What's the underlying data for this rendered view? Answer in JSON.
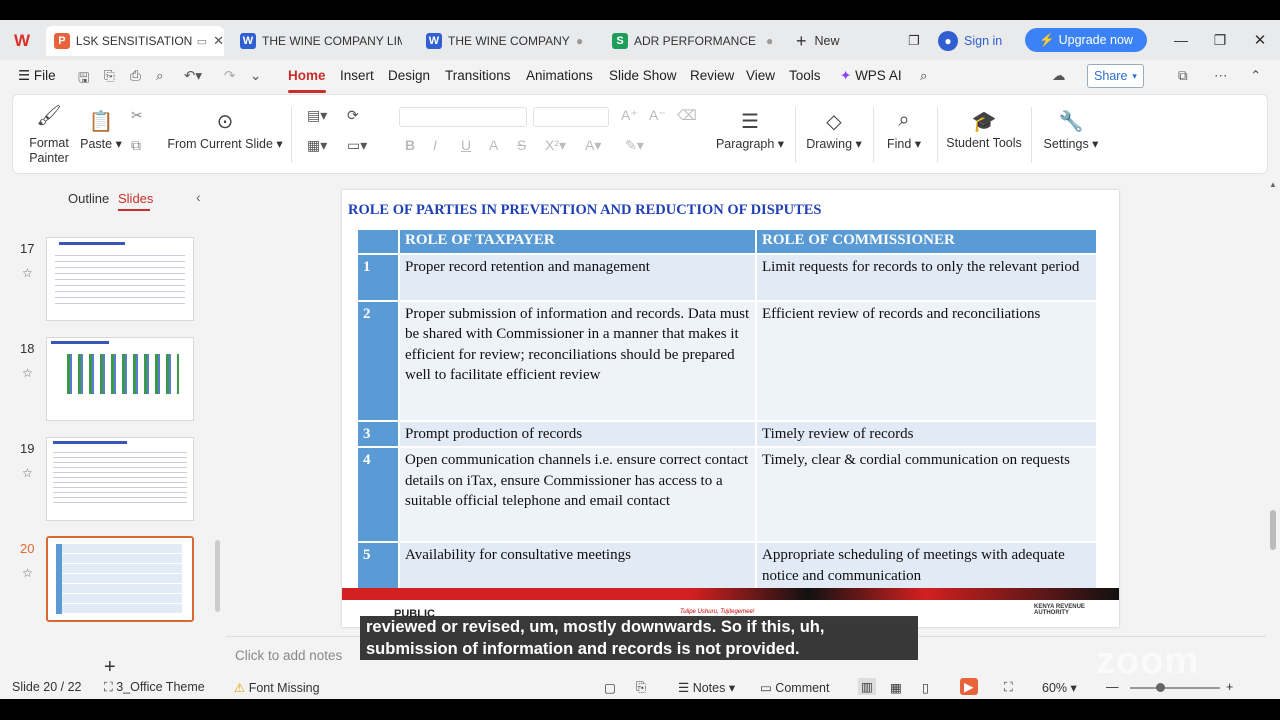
{
  "tabs": [
    {
      "label": "LSK SENSITISATION",
      "letter": "P",
      "color": "#e8623a"
    },
    {
      "label": "THE WINE COMPANY LIM",
      "letter": "W",
      "color": "#2f5fd0"
    },
    {
      "label": "THE WINE COMPANY L",
      "letter": "W",
      "color": "#2f5fd0"
    },
    {
      "label": "ADR PERFORMANCE R",
      "letter": "S",
      "color": "#1e9e5a"
    }
  ],
  "titlebar": {
    "new_label": "New",
    "signin_label": "Sign in",
    "upgrade_label": "Upgrade now"
  },
  "menu": {
    "file": "File",
    "items": [
      "Home",
      "Insert",
      "Design",
      "Transitions",
      "Animations",
      "Slide Show",
      "Review",
      "View",
      "Tools",
      "WPS AI"
    ],
    "share": "Share"
  },
  "ribbon": {
    "format_painter": "Format\nPainter",
    "paste": "Paste",
    "from_current": "From Current Slide",
    "paragraph": "Paragraph",
    "drawing": "Drawing",
    "find": "Find",
    "student_tools": "Student Tools",
    "settings": "Settings"
  },
  "panel": {
    "outline": "Outline",
    "slides": "Slides",
    "numbers": [
      "17",
      "18",
      "19",
      "20"
    ]
  },
  "slide": {
    "title": "ROLE OF  PARTIES IN PREVENTION AND REDUCTION OF DISPUTES",
    "col_taxpayer": "ROLE OF TAXPAYER",
    "col_commissioner": "ROLE OF COMMISSIONER",
    "rows": [
      {
        "num": "1",
        "taxpayer": "Proper record retention and management",
        "commissioner": "Limit requests for records to only the relevant period"
      },
      {
        "num": "2",
        "taxpayer": "Proper submission of information and records. Data must be shared with Commissioner in a manner that makes it efficient for review; reconciliations should be prepared well to facilitate efficient review",
        "commissioner": "Efficient review of records and reconciliations"
      },
      {
        "num": "3",
        "taxpayer": "Prompt production of records",
        "commissioner": "Timely review of records"
      },
      {
        "num": "4",
        "taxpayer": "Open communication channels i.e.  ensure correct contact details on iTax, ensure Commissioner has access to a suitable  official telephone and email contact",
        "commissioner": "Timely, clear &  cordial communication on requests"
      },
      {
        "num": "5",
        "taxpayer": "Availability for consultative meetings",
        "commissioner": "Appropriate scheduling of meetings with adequate notice and communication"
      }
    ],
    "footer_public": "PUBLIC",
    "footer_motto": "Tulipe Ushuru, Tujitegemee!",
    "footer_org": "KENYA REVENUE AUTHORITY"
  },
  "caption": "reviewed or revised, um, mostly downwards. So if this, uh, submission of information and records is not provided.",
  "notes_placeholder": "Click to add notes",
  "zoom_watermark": "zoom",
  "status": {
    "slide": "Slide 20 / 22",
    "theme": "3_Office Theme",
    "font_missing": "Font Missing",
    "notes": "Notes",
    "comment": "Comment",
    "zoom": "60%"
  }
}
